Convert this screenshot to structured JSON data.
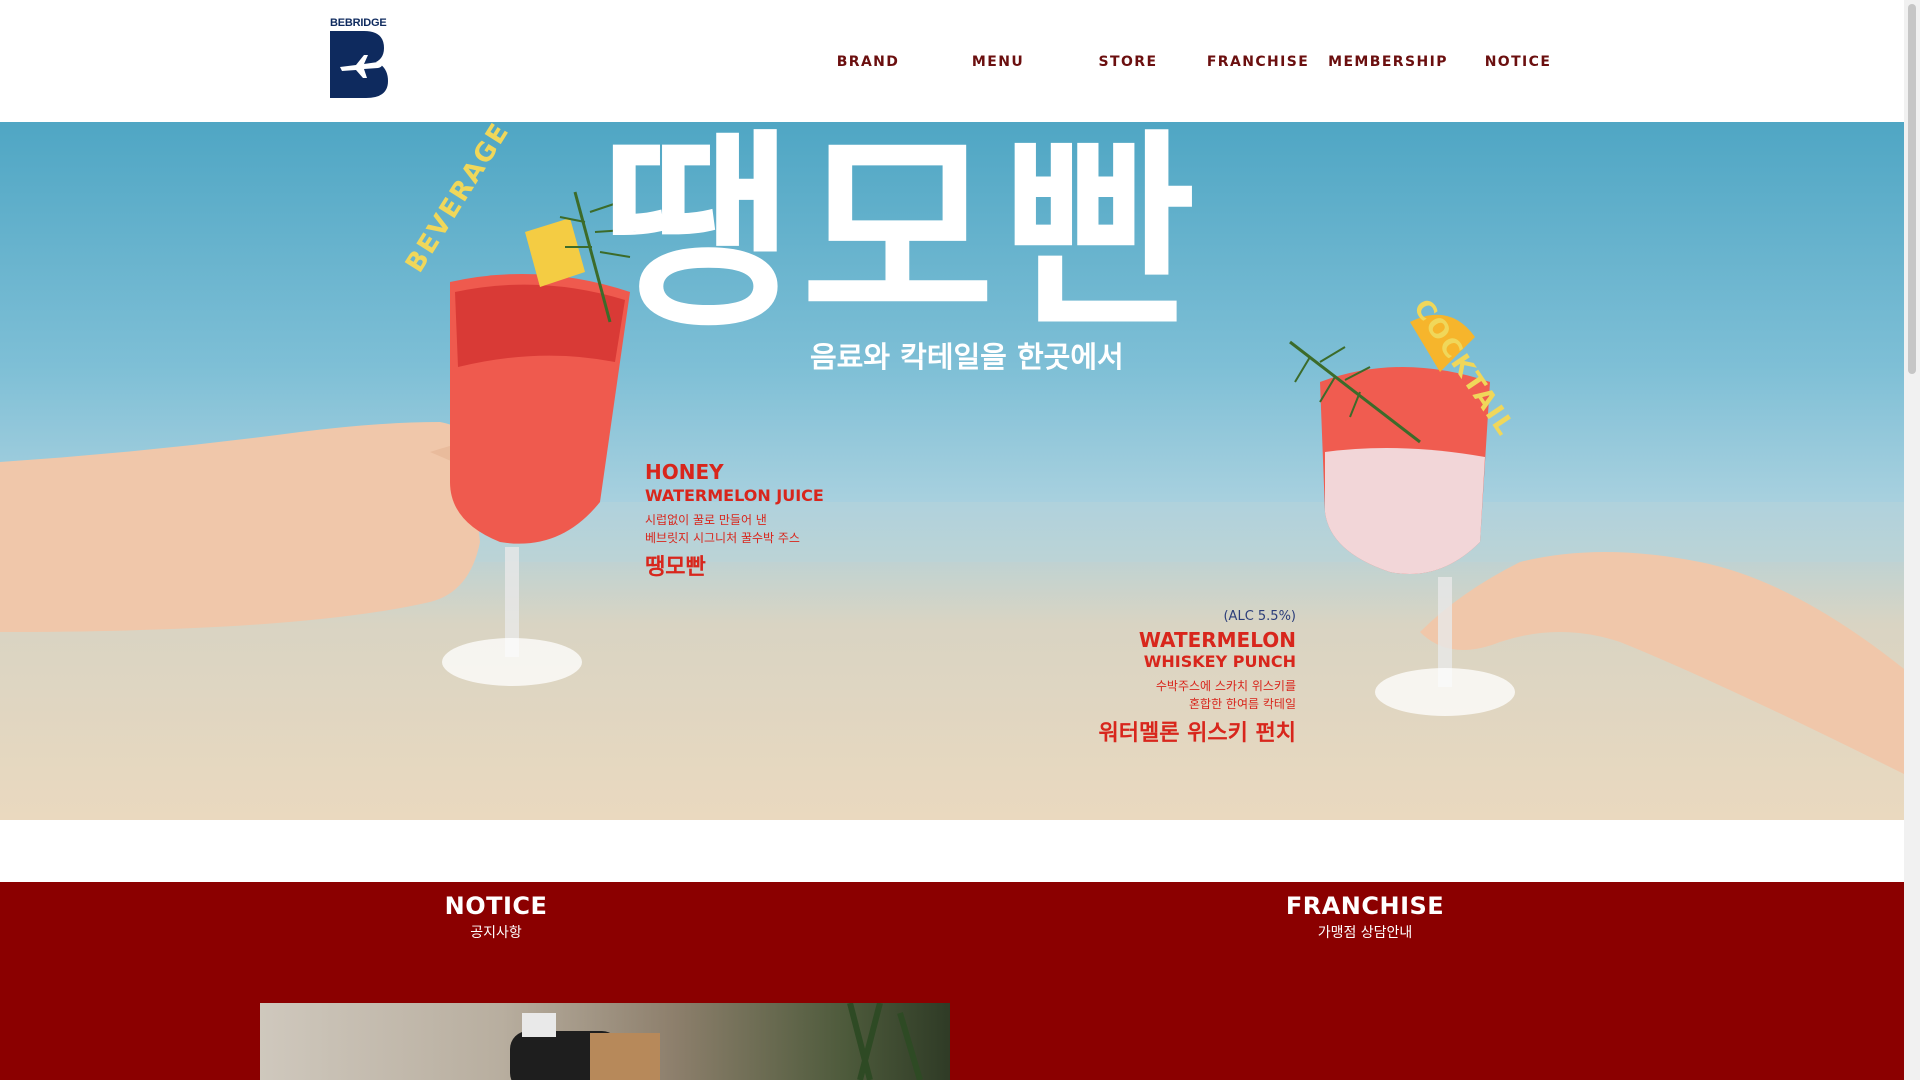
{
  "header": {
    "logo_text": "BEBRIDGE",
    "nav": [
      "BRAND",
      "MENU",
      "STORE",
      "FRANCHISE",
      "MEMBERSHIP",
      "NOTICE"
    ]
  },
  "hero": {
    "title": "땡모빤",
    "subtitle": "음료와 칵테일을 한곳에서",
    "tag_left": "BEVERAGE",
    "tag_right": "COCKTAIL",
    "product1": {
      "name_line1": "HONEY",
      "name_line2": "WATERMELON JUICE",
      "desc_line1": "시럽없이 꿀로 만들어 낸",
      "desc_line2": "베브릿지 시그니처 꿀수박 주스",
      "korean_name": "땡모빤"
    },
    "product2": {
      "alc": "(ALC 5.5%)",
      "name_line1": "WATERMELON",
      "name_line2": "WHISKEY PUNCH",
      "desc_line1": "수박주스에 스카치 위스키를",
      "desc_line2": "혼합한 한여름 칵테일",
      "korean_name": "워터멜론 위스키 펀치"
    }
  },
  "sections": {
    "notice": {
      "title": "NOTICE",
      "subtitle": "공지사항"
    },
    "franchise": {
      "title": "FRANCHISE",
      "subtitle": "가맹점 상담안내"
    }
  },
  "colors": {
    "nav_text": "#6b0f0f",
    "brand_navy": "#0e2a5e",
    "section_bg": "#8b0000",
    "accent_red": "#d8261c",
    "accent_yellow": "#f0d75a"
  }
}
